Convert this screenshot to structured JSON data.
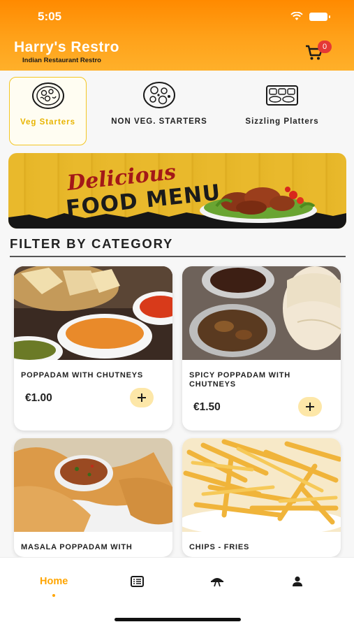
{
  "status_bar": {
    "time": "5:05"
  },
  "header": {
    "title": "Harry's Restro",
    "subtitle": "Indian Restaurant Restro",
    "cart_count": "0",
    "accent_color": "#ff9a00"
  },
  "categories": [
    {
      "label": "Veg Starters",
      "icon": "veg-plate-icon",
      "active": true
    },
    {
      "label": "NON VEG. STARTERS",
      "icon": "nonveg-plate-icon",
      "active": false
    },
    {
      "label": "Sizzling Platters",
      "icon": "platter-tray-icon",
      "active": false
    }
  ],
  "banner": {
    "line1": "Delicious",
    "line2": "FOOD MENU"
  },
  "filter": {
    "title": "FILTER BY CATEGORY"
  },
  "products": [
    {
      "name": "POPPADAM WITH CHUTNEYS",
      "price": "€1.00"
    },
    {
      "name": "SPICY POPPADAM WITH CHUTNEYS",
      "price": "€1.50"
    },
    {
      "name": "MASALA POPPADAM WITH",
      "price": ""
    },
    {
      "name": "CHIPS - FRIES",
      "price": ""
    }
  ],
  "bottom_nav": [
    {
      "label": "Home",
      "icon": "home-icon",
      "active": true
    },
    {
      "label": "",
      "icon": "menu-list-icon",
      "active": false
    },
    {
      "label": "",
      "icon": "dish-cloche-icon",
      "active": false
    },
    {
      "label": "",
      "icon": "profile-icon",
      "active": false
    }
  ]
}
